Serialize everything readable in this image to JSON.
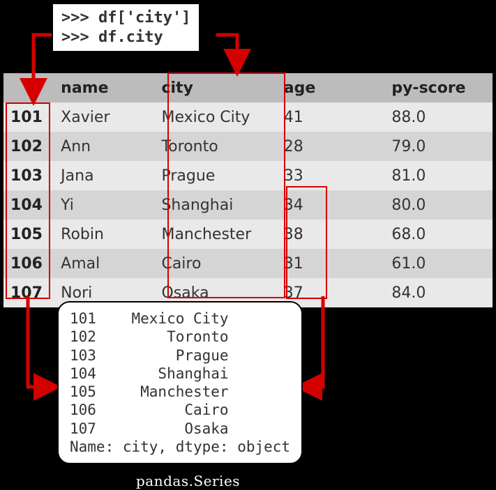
{
  "code": {
    "line1": ">>> df['city']",
    "line2": ">>> df.city"
  },
  "columns": {
    "index": "",
    "name": "name",
    "city": "city",
    "age": "age",
    "score": "py-score"
  },
  "rows": [
    {
      "idx": "101",
      "name": "Xavier",
      "city": "Mexico City",
      "age": "41",
      "score": "88.0"
    },
    {
      "idx": "102",
      "name": "Ann",
      "city": "Toronto",
      "age": "28",
      "score": "79.0"
    },
    {
      "idx": "103",
      "name": "Jana",
      "city": "Prague",
      "age": "33",
      "score": "81.0"
    },
    {
      "idx": "104",
      "name": "Yi",
      "city": "Shanghai",
      "age": "34",
      "score": "80.0"
    },
    {
      "idx": "105",
      "name": "Robin",
      "city": "Manchester",
      "age": "38",
      "score": "68.0"
    },
    {
      "idx": "106",
      "name": "Amal",
      "city": "Cairo",
      "age": "31",
      "score": "61.0"
    },
    {
      "idx": "107",
      "name": "Nori",
      "city": "Osaka",
      "age": "37",
      "score": "84.0"
    }
  ],
  "series_output": "101    Mexico City\n102        Toronto\n103         Prague\n104       Shanghai\n105     Manchester\n106          Cairo\n107          Osaka\nName: city, dtype: object",
  "caption": "pandas.Series"
}
